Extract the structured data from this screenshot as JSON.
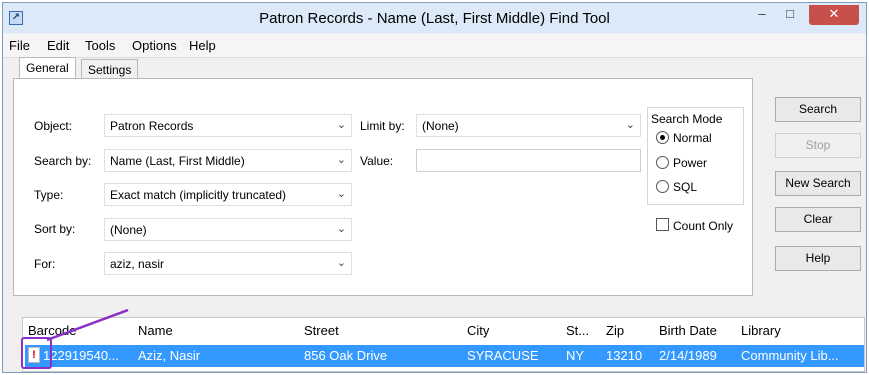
{
  "window": {
    "title": "Patron Records - Name (Last, First Middle) Find Tool",
    "minimize": "–",
    "maximize": "□",
    "close": "✕"
  },
  "menu": {
    "file": "File",
    "edit": "Edit",
    "tools": "Tools",
    "options": "Options",
    "help": "Help"
  },
  "tabs": {
    "general": "General",
    "settings": "Settings"
  },
  "form": {
    "object_label": "Object:",
    "object_value": "Patron Records",
    "search_by_label": "Search by:",
    "search_by_value": "Name (Last, First Middle)",
    "type_label": "Type:",
    "type_value": "Exact match (implicitly truncated)",
    "sort_by_label": "Sort by:",
    "sort_by_value": "(None)",
    "for_label": "For:",
    "for_value": "aziz, nasir",
    "limit_by_label": "Limit by:",
    "limit_by_value": "(None)",
    "value_label": "Value:",
    "value_value": ""
  },
  "search_mode": {
    "title": "Search Mode",
    "normal": "Normal",
    "power": "Power",
    "sql": "SQL",
    "selected": "Normal",
    "count_only": "Count Only"
  },
  "buttons": {
    "search": "Search",
    "stop": "Stop",
    "new_search": "New Search",
    "clear": "Clear",
    "help": "Help"
  },
  "results": {
    "columns": [
      "Barcode",
      "Name",
      "Street",
      "City",
      "St...",
      "Zip",
      "Birth Date",
      "Library"
    ],
    "rows": [
      {
        "flag": "!",
        "barcode": "122919540...",
        "name": "Aziz, Nasir",
        "street": "856 Oak Drive",
        "city": "SYRACUSE",
        "state": "NY",
        "zip": "13210",
        "birth_date": "2/14/1989",
        "library": "Community Lib..."
      }
    ]
  },
  "colors": {
    "selection": "#3399ff",
    "close_button": "#c7504b",
    "annotation": "#8b2fc9",
    "title_bar": "#dbe9f8"
  }
}
